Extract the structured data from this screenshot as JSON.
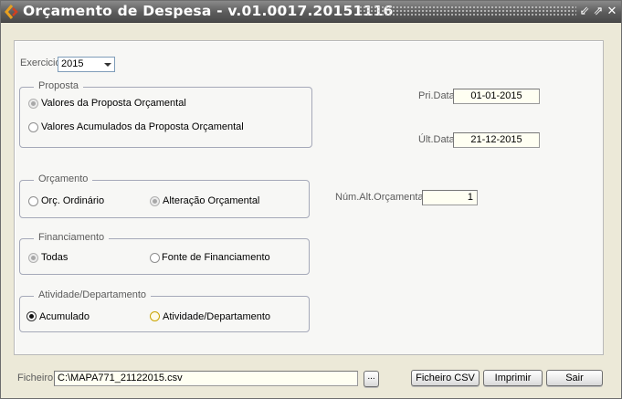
{
  "window": {
    "title": "Orçamento de Despesa - v.01.0017.20151116",
    "icon": "app-logo-icon",
    "controls": [
      "minimize-icon",
      "restore-icon",
      "close-icon"
    ],
    "title_bar_color": "#5c5c5c"
  },
  "exercicio": {
    "label": "Exercicio:",
    "value": "2015"
  },
  "proposta": {
    "legend": "Proposta",
    "options": [
      {
        "label": "Valores da Proposta Orçamental",
        "selected": true,
        "enabled": false
      },
      {
        "label": "Valores Acumulados da Proposta Orçamental",
        "selected": false,
        "enabled": true
      }
    ]
  },
  "dates": {
    "pri_label": "Pri.Data",
    "pri_value": "01-01-2015",
    "ult_label": "Últ.Data",
    "ult_value": "21-12-2015"
  },
  "orcamento": {
    "legend": "Orçamento",
    "options": [
      {
        "label": "Orç. Ordinário",
        "selected": false,
        "enabled": true
      },
      {
        "label": "Alteração Orçamental",
        "selected": true,
        "enabled": false
      }
    ]
  },
  "num_alt": {
    "label": "Núm.Alt.Orçamental",
    "value": "1"
  },
  "financiamento": {
    "legend": "Financiamento",
    "options": [
      {
        "label": "Todas",
        "selected": true,
        "enabled": false
      },
      {
        "label": "Fonte de Financiamento",
        "selected": false,
        "enabled": true
      }
    ]
  },
  "atividade": {
    "legend": "Atividade/Departamento",
    "options": [
      {
        "label": "Acumulado",
        "selected": true,
        "enabled": true
      },
      {
        "label": "Atividade/Departamento",
        "selected": false,
        "enabled": true
      }
    ]
  },
  "ficheiro": {
    "label": "Ficheiro:",
    "value": "C:\\MAPA771_21122015.csv",
    "browse_label": "..."
  },
  "buttons": {
    "csv": "Ficheiro CSV",
    "print": "Imprimir",
    "exit": "Sair"
  }
}
